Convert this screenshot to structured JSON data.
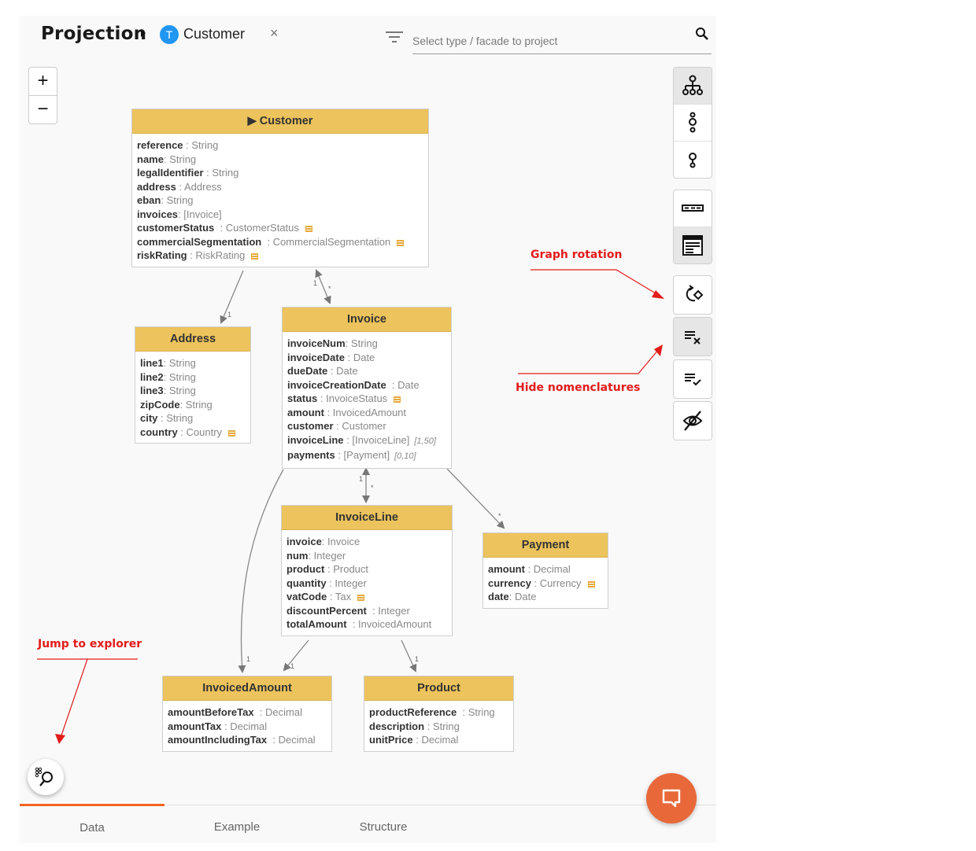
{
  "header": {
    "title": "Projection",
    "type_badge": "T",
    "selected_type": "Customer",
    "close_symbol": "×",
    "search_placeholder": "Select type / facade to project"
  },
  "zoom": {
    "in": "+",
    "out": "−"
  },
  "toolbar": {
    "layout_group": [
      {
        "icon": "hierarchy-tree-icon",
        "active": true
      },
      {
        "icon": "chain-nodes-icon",
        "active": false
      },
      {
        "icon": "single-node-icon",
        "active": false
      }
    ],
    "view_group": [
      {
        "icon": "compact-view-icon",
        "active": false
      },
      {
        "icon": "detailed-view-icon",
        "active": true
      }
    ],
    "actions": [
      {
        "icon": "graph-rotation-icon",
        "active": false
      },
      {
        "icon": "hide-nomenclatures-icon",
        "active": true
      },
      {
        "icon": "show-nomenclatures-icon",
        "active": false
      },
      {
        "icon": "visibility-off-icon",
        "active": false
      }
    ]
  },
  "annotations": {
    "graph_rotation": "Graph rotation",
    "hide_nomenclatures": "Hide nomenclatures",
    "jump_to_explorer": "Jump to explorer",
    "color": "#e31b1b"
  },
  "diagram": {
    "header_color": "#ecc35c",
    "nodes": [
      {
        "id": "customer",
        "title": "▶ Customer",
        "attrs": [
          {
            "name": "reference",
            "type": " : String"
          },
          {
            "name": "name",
            "type": ": String"
          },
          {
            "name": "legalIdentifier",
            "type": " : String"
          },
          {
            "name": "address",
            "type": " : Address"
          },
          {
            "name": "eban",
            "type": ": String"
          },
          {
            "name": "invoices",
            "type": ": [Invoice]"
          },
          {
            "name": "customerStatus",
            "type": "  : CustomerStatus",
            "enum": true
          },
          {
            "name": "commercialSegmentation",
            "type": "  : CommercialSegmentation",
            "enum": true
          },
          {
            "name": "riskRating",
            "type": " : RiskRating",
            "enum": true
          }
        ]
      },
      {
        "id": "address",
        "title": "Address",
        "attrs": [
          {
            "name": "line1",
            "type": ": String"
          },
          {
            "name": "line2",
            "type": ": String"
          },
          {
            "name": "line3",
            "type": ": String"
          },
          {
            "name": "zipCode",
            "type": ": String"
          },
          {
            "name": "city",
            "type": " : String"
          },
          {
            "name": "country",
            "type": " : Country",
            "enum": true
          }
        ]
      },
      {
        "id": "invoice",
        "title": "Invoice",
        "attrs": [
          {
            "name": "invoiceNum",
            "type": ": String"
          },
          {
            "name": "invoiceDate",
            "type": " : Date"
          },
          {
            "name": "dueDate",
            "type": " : Date"
          },
          {
            "name": "invoiceCreationDate",
            "type": "  : Date"
          },
          {
            "name": "status",
            "type": " : InvoiceStatus",
            "enum": true
          },
          {
            "name": "amount",
            "type": " : InvoicedAmount"
          },
          {
            "name": "customer",
            "type": " : Customer"
          },
          {
            "name": "invoiceLine",
            "type": " : [InvoiceLine]",
            "card": "[1,50]"
          },
          {
            "name": "payments",
            "type": " : [Payment]",
            "card": "[0,10]"
          }
        ]
      },
      {
        "id": "invoiceline",
        "title": "InvoiceLine",
        "attrs": [
          {
            "name": "invoice",
            "type": ": Invoice"
          },
          {
            "name": "num",
            "type": ": Integer"
          },
          {
            "name": "product",
            "type": " : Product"
          },
          {
            "name": "quantity",
            "type": " : Integer"
          },
          {
            "name": "vatCode",
            "type": " : Tax",
            "enum": true
          },
          {
            "name": "discountPercent",
            "type": "  : Integer"
          },
          {
            "name": "totalAmount",
            "type": "  : InvoicedAmount"
          }
        ]
      },
      {
        "id": "payment",
        "title": "Payment",
        "attrs": [
          {
            "name": "amount",
            "type": " : Decimal"
          },
          {
            "name": "currency",
            "type": " : Currency",
            "enum": true
          },
          {
            "name": "date",
            "type": ": Date"
          }
        ]
      },
      {
        "id": "invoicedamount",
        "title": "InvoicedAmount",
        "attrs": [
          {
            "name": "amountBeforeTax",
            "type": "  : Decimal"
          },
          {
            "name": "amountTax",
            "type": " : Decimal"
          },
          {
            "name": "amountIncludingTax",
            "type": "  : Decimal"
          }
        ]
      },
      {
        "id": "product",
        "title": "Product",
        "attrs": [
          {
            "name": "productReference",
            "type": "  : String"
          },
          {
            "name": "description",
            "type": " : String"
          },
          {
            "name": "unitPrice",
            "type": " : Decimal"
          }
        ]
      }
    ],
    "edges": [
      {
        "from": "customer",
        "to": "address",
        "labels": [
          "1"
        ],
        "bidirectional": false
      },
      {
        "from": "customer",
        "to": "invoice",
        "labels": [
          "1",
          "*"
        ],
        "bidirectional": true
      },
      {
        "from": "invoice",
        "to": "invoiceline",
        "labels": [
          "1",
          "*"
        ],
        "bidirectional": true
      },
      {
        "from": "invoice",
        "to": "payment",
        "labels": [
          "*"
        ],
        "bidirectional": false
      },
      {
        "from": "invoice",
        "to": "invoicedamount",
        "labels": [
          "1"
        ],
        "bidirectional": false
      },
      {
        "from": "invoiceline",
        "to": "invoicedamount",
        "labels": [
          "1"
        ],
        "bidirectional": false
      },
      {
        "from": "invoiceline",
        "to": "product",
        "labels": [
          "1"
        ],
        "bidirectional": false
      }
    ]
  },
  "tabs": [
    {
      "label": "Data",
      "active": true
    },
    {
      "label": "Example",
      "active": false
    },
    {
      "label": "Structure",
      "active": false
    }
  ],
  "accent_color": "#f26522",
  "chat_button_color": "#e8683a"
}
